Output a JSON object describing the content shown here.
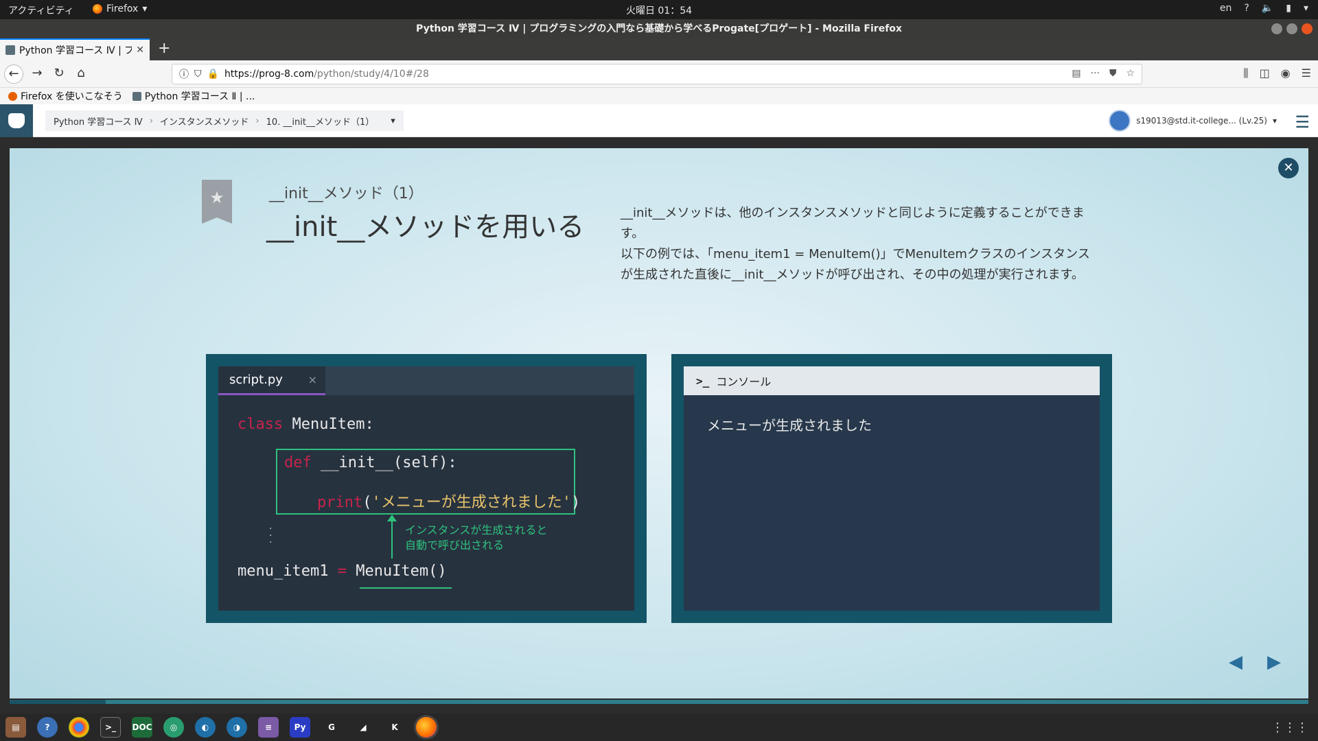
{
  "system": {
    "activities": "アクティビティ",
    "app_name": "Firefox",
    "clock": "火曜日 01：54",
    "lang": "en",
    "help": "?"
  },
  "window": {
    "title": "Python 学習コース Ⅳ | プログラミングの入門なら基礎から学べるProgate[プロゲート] - Mozilla Firefox"
  },
  "browser": {
    "tab_title": "Python 学習コース Ⅳ | プ",
    "new_tab": "+",
    "url_host": "https://prog-8.com",
    "url_path": "/python/study/4/10#/28",
    "bookmarks": [
      {
        "label": "Firefox を使いこなそう"
      },
      {
        "label": "Python 学習コース Ⅱ | ..."
      }
    ]
  },
  "header": {
    "breadcrumb": [
      "Python 学習コース Ⅳ",
      "インスタンスメソッド",
      "10. __init__メソッド（1）"
    ],
    "user": "s19013@std.it-college... (Lv.25)"
  },
  "slide": {
    "subtitle": "__init__メソッド（1）",
    "heading": "__init__メソッドを用いる",
    "description_1": "__init__メソッドは、他のインスタンスメソッドと同じように定義することができます。",
    "description_2": "以下の例では、「menu_item1 = MenuItem()」でMenuItemクラスのインスタンスが生成された直後に__init__メソッドが呼び出され、その中の処理が実行されます。",
    "editor": {
      "file_tab": "script.py",
      "tab_close": "×",
      "line1_kw": "class",
      "line1_rest": " MenuItem:",
      "line2_kw": "def",
      "line2_rest": " __init__(self):",
      "line3_kw": "print",
      "line3_open": "(",
      "line3_str": "'メニューが生成されました'",
      "line3_close": ")",
      "line4_var": "menu_item1 ",
      "line4_eq": "=",
      "line4_call": " MenuItem()",
      "note_1": "インスタンスが生成されると",
      "note_2": "自動で呼び出される"
    },
    "console": {
      "prompt": ">_",
      "title": "コンソール",
      "output": "メニューが生成されました"
    }
  },
  "colors": {
    "panel_bg": "#135466",
    "editor_bg": "#27323f",
    "keyword": "#c7244b",
    "string": "#e8c46a",
    "accent_green": "#2ec27e"
  }
}
